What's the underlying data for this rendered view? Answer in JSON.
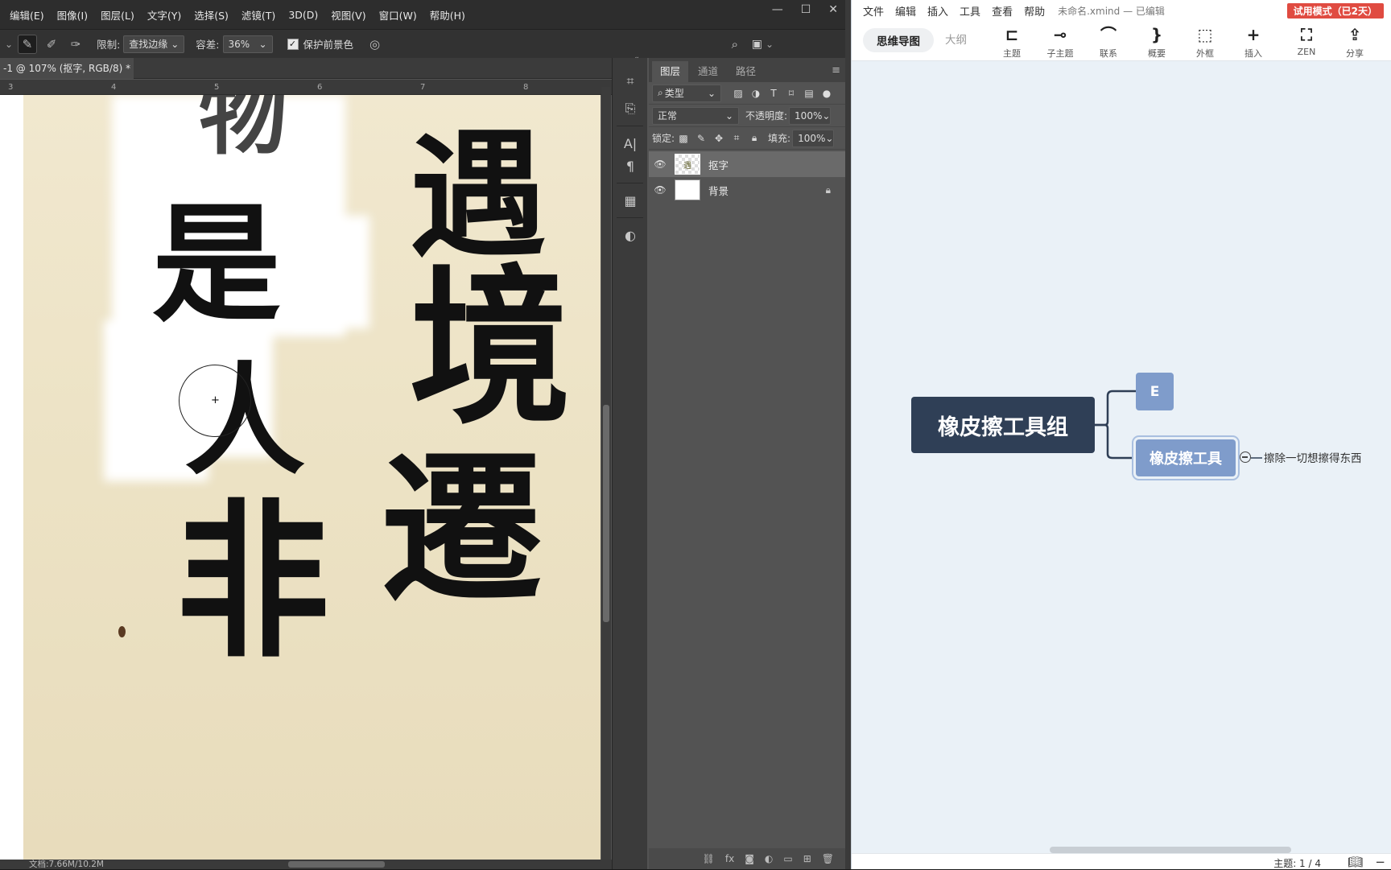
{
  "photoshop": {
    "menu": [
      "编辑(E)",
      "图像(I)",
      "图层(L)",
      "文字(Y)",
      "选择(S)",
      "滤镜(T)",
      "3D(D)",
      "视图(V)",
      "窗口(W)",
      "帮助(H)"
    ],
    "window_controls": {
      "minimize": "—",
      "maximize": "☐",
      "close": "✕"
    },
    "options": {
      "limit_label": "限制:",
      "limit_value": "查找边缘",
      "tolerance_label": "容差:",
      "tolerance_value": "36%",
      "protect_label": "保护前景色",
      "protect_checked": true
    },
    "document_tab": {
      "title": "-1 @ 107% (抠字, RGB/8) *",
      "close": "×"
    },
    "ruler_ticks": [
      "3",
      "4",
      "5",
      "6",
      "7",
      "8"
    ],
    "canvas": {
      "characters": [
        "遇",
        "境",
        "遷",
        "是",
        "人",
        "非",
        "物"
      ],
      "paper_color": "#ede3c6",
      "ink_color": "#111111"
    },
    "status": "文档:7.66M/10.2M",
    "panel": {
      "tabs": [
        "图层",
        "通道",
        "路径"
      ],
      "active_tab": "图层",
      "filter_kind": "类型",
      "blend_mode": "正常",
      "opacity_label": "不透明度:",
      "opacity_value": "100%",
      "lock_label": "锁定:",
      "fill_label": "填充:",
      "fill_value": "100%",
      "layers": [
        {
          "name": "抠字",
          "selected": true,
          "visible": true,
          "locked": false
        },
        {
          "name": "背景",
          "selected": false,
          "visible": true,
          "locked": true
        }
      ]
    }
  },
  "xmind": {
    "menu": [
      "文件",
      "编辑",
      "插入",
      "工具",
      "查看",
      "帮助"
    ],
    "file_name": "未命名.xmind — 已编辑",
    "trial_badge": "试用模式（已2天）",
    "view_tabs": {
      "mindmap": "思维导图",
      "outline": "大纲"
    },
    "toolbar": [
      {
        "icon": "topic-icon",
        "label": "主题",
        "glyph": "⊏"
      },
      {
        "icon": "subtopic-icon",
        "label": "子主题",
        "glyph": "⊸"
      },
      {
        "icon": "relationship-icon",
        "label": "联系",
        "glyph": "⌒"
      },
      {
        "icon": "summary-icon",
        "label": "概要",
        "glyph": "}"
      },
      {
        "icon": "boundary-icon",
        "label": "外框",
        "glyph": "⬚"
      },
      {
        "icon": "insert-icon",
        "label": "插入",
        "glyph": "+"
      },
      {
        "icon": "zen-icon",
        "label": "ZEN",
        "glyph": "⛶"
      },
      {
        "icon": "share-icon",
        "label": "分享",
        "glyph": "⇪"
      }
    ],
    "map": {
      "root": "橡皮擦工具组",
      "children": [
        {
          "label": "E"
        },
        {
          "label": "橡皮擦工具",
          "note": "擦除一切想擦得东西"
        }
      ],
      "colors": {
        "root": "#2f3f56",
        "topic": "#7f9ccb",
        "line": "#2f3f56"
      }
    },
    "status": {
      "topic_count": "主题: 1 / 4"
    }
  }
}
